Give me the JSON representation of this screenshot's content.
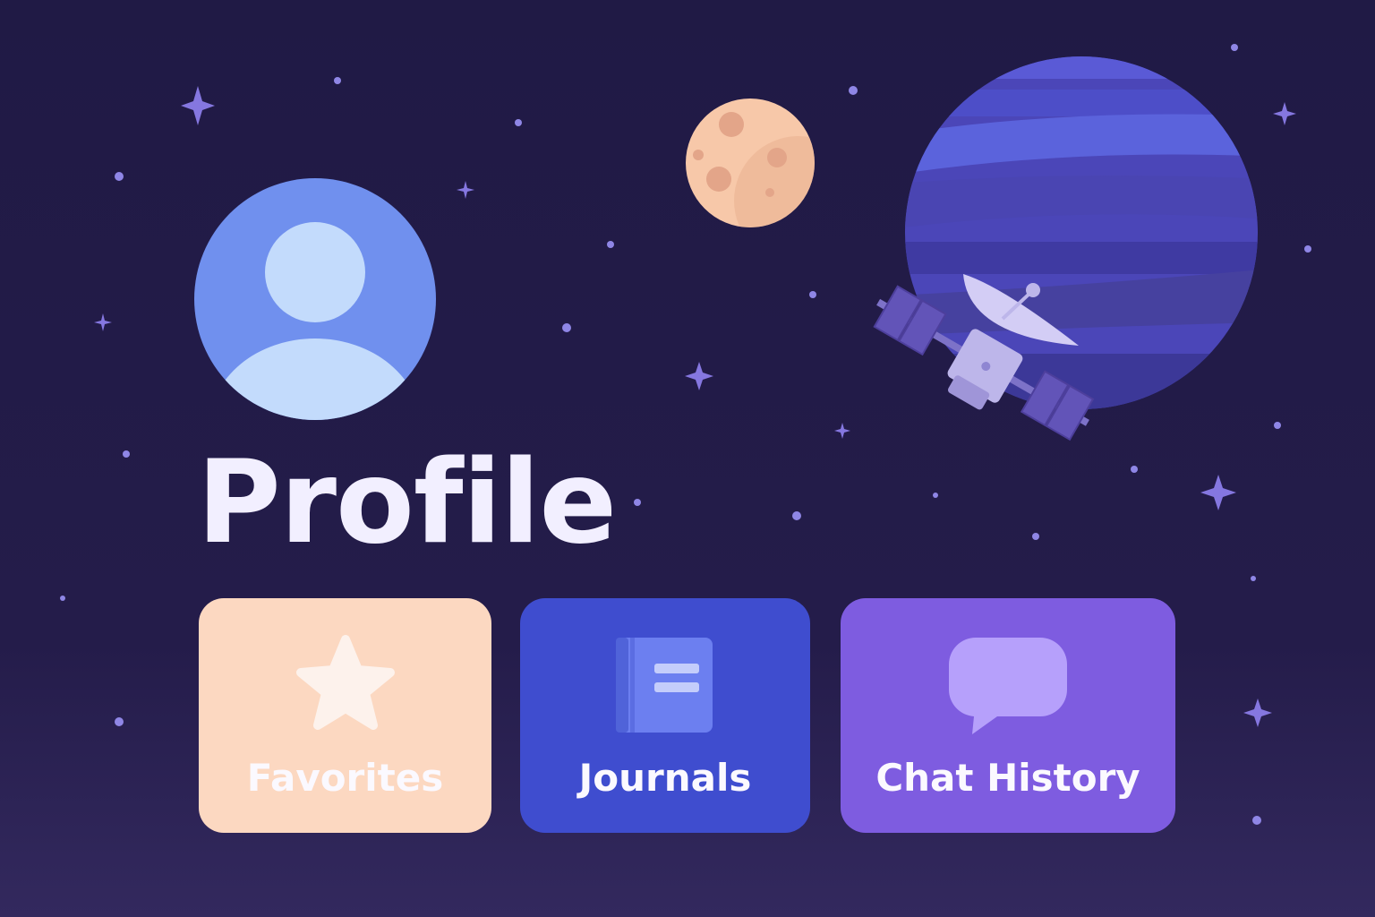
{
  "page": {
    "title": "Profile"
  },
  "tiles": [
    {
      "label": "Favorites",
      "icon": "star-icon",
      "color": "#fcd8c1"
    },
    {
      "label": "Journals",
      "icon": "book-icon",
      "color": "#3f4dcf"
    },
    {
      "label": "Chat History",
      "icon": "chat-bubble-icon",
      "color": "#7e5ce0"
    }
  ],
  "decorations": {
    "background": "#201a45",
    "moon": "moon-illustration",
    "planet": "planet-illustration",
    "satellite": "satellite-illustration"
  }
}
